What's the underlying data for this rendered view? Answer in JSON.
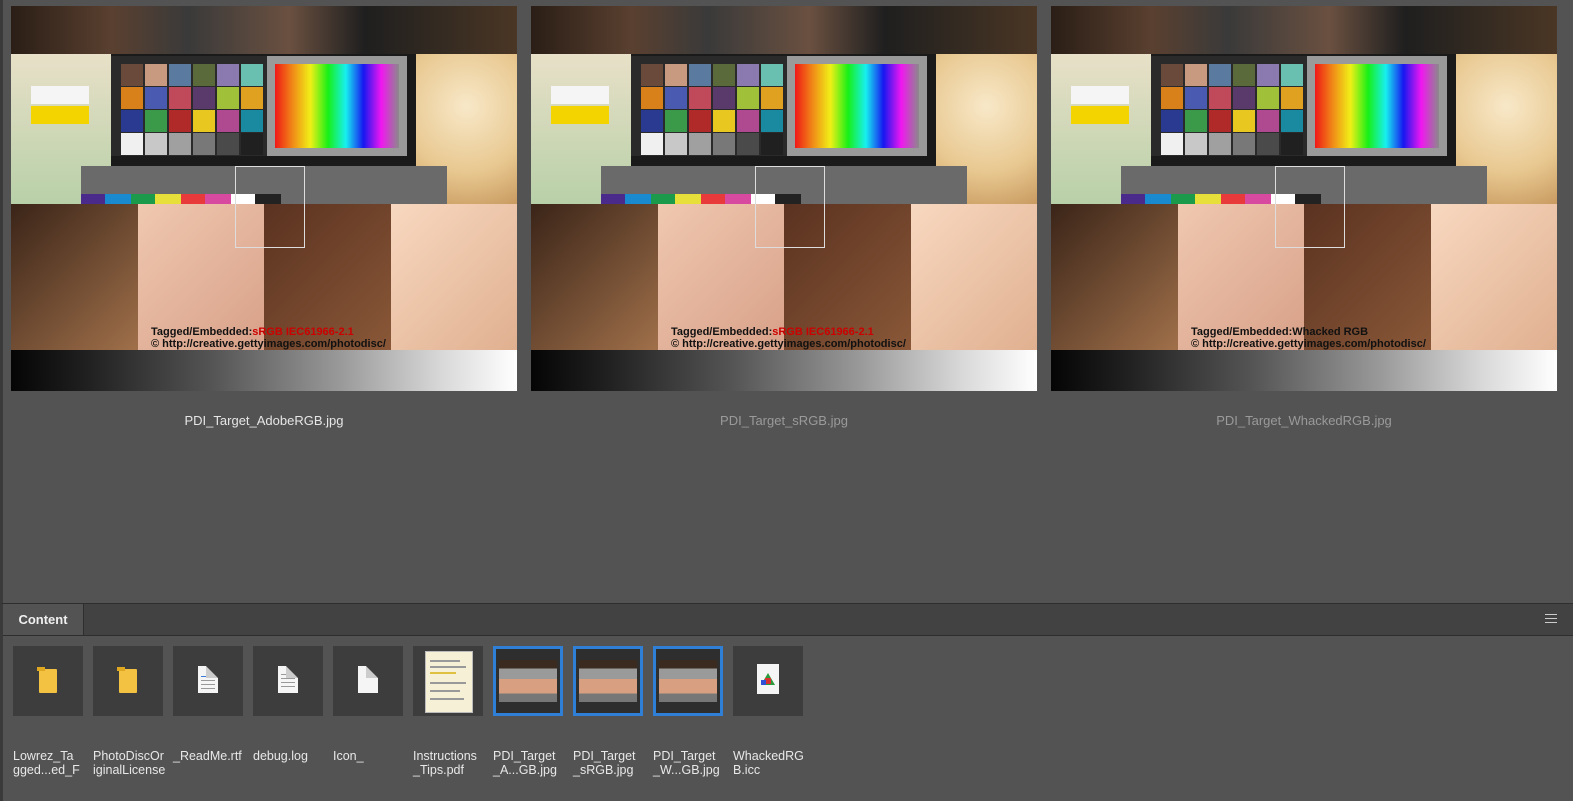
{
  "preview": {
    "items": [
      {
        "caption": "PDI_Target_AdobeRGB.jpg",
        "overlay_line1": "Tagged/Embedded:",
        "overlay_profile": "sRGB IEC61966-2.1",
        "overlay_line2": "© http://creative.gettyimages.com/photodisc/"
      },
      {
        "caption": "PDI_Target_sRGB.jpg",
        "overlay_line1": "Tagged/Embedded:",
        "overlay_profile": "sRGB IEC61966-2.1",
        "overlay_line2": "© http://creative.gettyimages.com/photodisc/"
      },
      {
        "caption": "PDI_Target_WhackedRGB.jpg",
        "overlay_line1": "Tagged/Embedded:",
        "overlay_profile": "Whacked RGB",
        "overlay_line2": "© http://creative.gettyimages.com/photodisc/"
      }
    ]
  },
  "content": {
    "tab_label": "Content",
    "files": [
      {
        "label": "Lowrez_Ta gged...ed_F",
        "type": "folder-icon",
        "selected": false
      },
      {
        "label": "PhotoDiscOr iginalLicense",
        "type": "folder-icon",
        "selected": false
      },
      {
        "label": "_ReadMe.rtf",
        "type": "rtf-document-icon",
        "selected": false
      },
      {
        "label": "debug.log",
        "type": "text-document-icon",
        "selected": false
      },
      {
        "label": "Icon_",
        "type": "blank-document-icon",
        "selected": false
      },
      {
        "label": "Instructions _Tips.pdf",
        "type": "pdf-thumbnail",
        "selected": false
      },
      {
        "label": "PDI_Target _A...GB.jpg",
        "type": "image-thumbnail",
        "selected": true
      },
      {
        "label": "PDI_Target _sRGB.jpg",
        "type": "image-thumbnail",
        "selected": true
      },
      {
        "label": "PDI_Target _W...GB.jpg",
        "type": "image-thumbnail",
        "selected": true
      },
      {
        "label": "WhackedRG B.icc",
        "type": "icc-profile-icon",
        "selected": false
      }
    ]
  },
  "colors": {
    "selection": "#2f7fd6",
    "background": "#535353",
    "folder": "#f4c242"
  }
}
